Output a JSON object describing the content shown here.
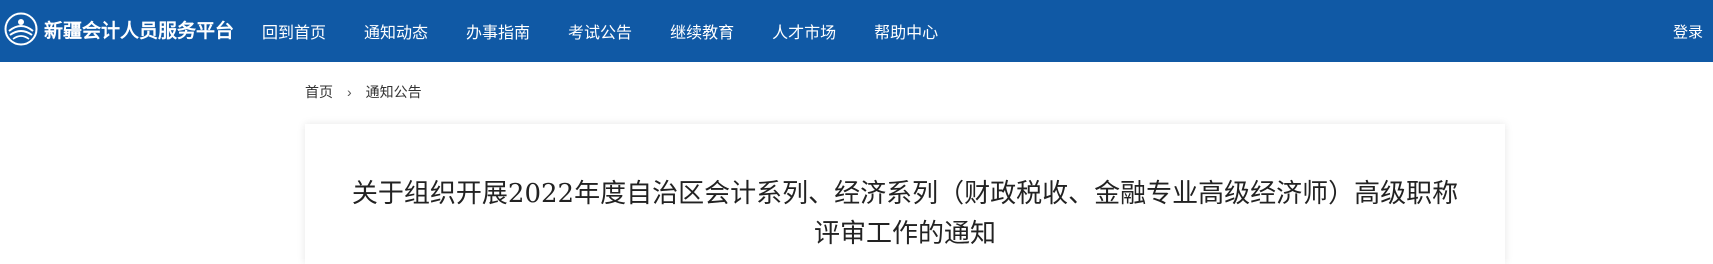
{
  "header": {
    "brand_title": "新疆会计人员服务平台",
    "logo_icon": "logo-emblem-icon",
    "background_color": "#1059a5",
    "nav_items": [
      {
        "label": "回到首页"
      },
      {
        "label": "通知动态"
      },
      {
        "label": "办事指南"
      },
      {
        "label": "考试公告"
      },
      {
        "label": "继续教育"
      },
      {
        "label": "人才市场"
      },
      {
        "label": "帮助中心"
      }
    ],
    "login_label": "登录"
  },
  "breadcrumb": {
    "home_label": "首页",
    "separator": "›",
    "current_label": "通知公告"
  },
  "article": {
    "title": "关于组织开展2022年度自治区会计系列、经济系列（财政税收、金融专业高级经济师）高级职称评审工作的通知"
  }
}
